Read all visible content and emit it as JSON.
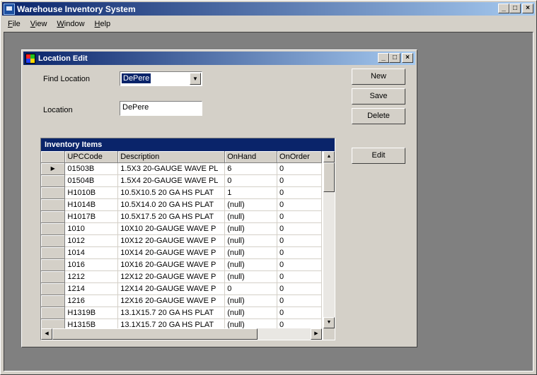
{
  "app": {
    "title": "Warehouse Inventory System"
  },
  "menu": [
    {
      "label": "File",
      "accel": "F",
      "rest": "ile"
    },
    {
      "label": "View",
      "accel": "V",
      "rest": "iew"
    },
    {
      "label": "Window",
      "accel": "W",
      "rest": "indow"
    },
    {
      "label": "Help",
      "accel": "H",
      "rest": "elp"
    }
  ],
  "child": {
    "title": "Location Edit",
    "find_label": "Find Location",
    "find_value": "DePere",
    "location_label": "Location",
    "location_value": "DePere",
    "buttons": {
      "new": "New",
      "save": "Save",
      "delete": "Delete",
      "edit": "Edit"
    }
  },
  "grid": {
    "caption": "Inventory Items",
    "columns": [
      "UPCCode",
      "Description",
      "OnHand",
      "OnOrder"
    ],
    "rows": [
      [
        "01503B",
        "1.5X3 20-GAUGE WAVE PL",
        "6",
        "0"
      ],
      [
        "01504B",
        "1.5X4 20-GAUGE WAVE PL",
        "0",
        "0"
      ],
      [
        "H1010B",
        "10.5X10.5  20 GA HS PLAT",
        "1",
        "0"
      ],
      [
        "H1014B",
        "10.5X14.0  20 GA HS PLAT",
        "(null)",
        "0"
      ],
      [
        "H1017B",
        "10.5X17.5  20 GA HS PLAT",
        "(null)",
        "0"
      ],
      [
        "1010",
        "10X10 20-GAUGE WAVE P",
        "(null)",
        "0"
      ],
      [
        "1012",
        "10X12 20-GAUGE WAVE P",
        "(null)",
        "0"
      ],
      [
        "1014",
        "10X14 20-GAUGE WAVE P",
        "(null)",
        "0"
      ],
      [
        "1016",
        "10X16 20-GAUGE WAVE P",
        "(null)",
        "0"
      ],
      [
        "1212",
        "12X12 20-GAUGE WAVE P",
        "(null)",
        "0"
      ],
      [
        "1214",
        "12X14 20-GAUGE WAVE P",
        "0",
        "0"
      ],
      [
        "1216",
        "12X16 20-GAUGE WAVE P",
        "(null)",
        "0"
      ],
      [
        "H1319B",
        "13.1X15.7  20 GA HS PLAT",
        "(null)",
        "0"
      ],
      [
        "H1315B",
        "13.1X15.7  20 GA HS PLAT",
        "(null)",
        "0"
      ]
    ],
    "current_row": 0
  },
  "icons": [
    "app-icon",
    "form-icon",
    "minimize-icon",
    "maximize-icon",
    "close-icon",
    "dropdown-arrow-icon",
    "row-pointer-icon",
    "scroll-up-icon",
    "scroll-down-icon",
    "scroll-left-icon",
    "scroll-right-icon"
  ]
}
